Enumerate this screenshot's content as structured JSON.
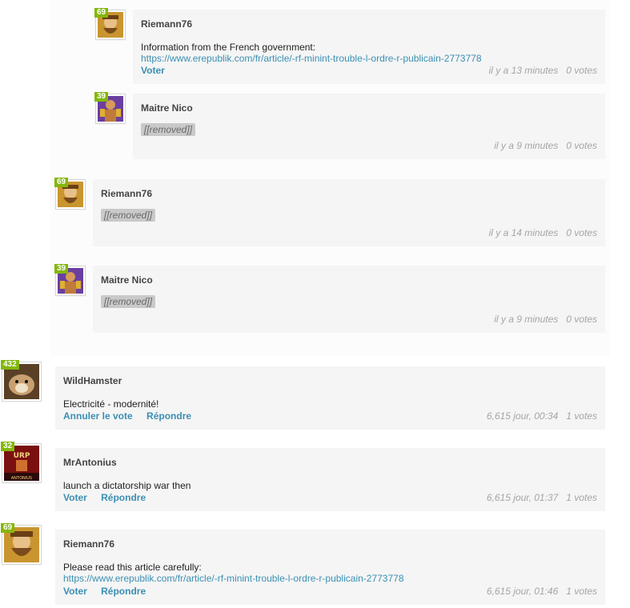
{
  "comments": [
    {
      "author": "Riemann76",
      "level": "69",
      "avatar_icon": "bearded-man-avatar",
      "text": "Information from the French government:",
      "link": "https://www.erepublik.com/fr/article/-rf-minint-trouble-l-ordre-r-publicain-2773778",
      "actions": [
        "Voter"
      ],
      "time": "il y a 13 minutes",
      "votes": "0 votes"
    },
    {
      "author": "Maitre Nico",
      "level": "39",
      "avatar_icon": "wrestler-avatar",
      "removed": "[[removed]]",
      "time": "il y a 9 minutes",
      "votes": "0 votes"
    },
    {
      "author": "Riemann76",
      "level": "69",
      "avatar_icon": "bearded-man-avatar",
      "removed": "[[removed]]",
      "time": "il y a 14 minutes",
      "votes": "0 votes"
    },
    {
      "author": "Maitre Nico",
      "level": "39",
      "avatar_icon": "wrestler-avatar",
      "removed": "[[removed]]",
      "time": "il y a 9 minutes",
      "votes": "0 votes"
    },
    {
      "author": "WildHamster",
      "level": "432",
      "avatar_icon": "hamster-avatar",
      "text": "Electricité - modernité!",
      "actions": [
        "Annuler le vote",
        "Répondre"
      ],
      "time": "6,615 jour, 00:34",
      "votes": "1 votes"
    },
    {
      "author": "MrAntonius",
      "level": "32",
      "avatar_icon": "poster-avatar",
      "text": "launch a dictatorship war then",
      "actions": [
        "Voter",
        "Répondre"
      ],
      "time": "6,615 jour, 01:37",
      "votes": "1 votes"
    },
    {
      "author": "Riemann76",
      "level": "69",
      "avatar_icon": "bearded-man-avatar",
      "text": "Please read this article carefully:",
      "link": "https://www.erepublik.com/fr/article/-rf-minint-trouble-l-ordre-r-publicain-2773778",
      "actions": [
        "Voter",
        "Répondre"
      ],
      "time": "6,615 jour, 01:46",
      "votes": "1 votes"
    }
  ],
  "colors": {
    "level_badge": "#83b70b",
    "link": "#3b8fb3",
    "box": "#f5f5f5",
    "meta": "#a5a5a5"
  }
}
